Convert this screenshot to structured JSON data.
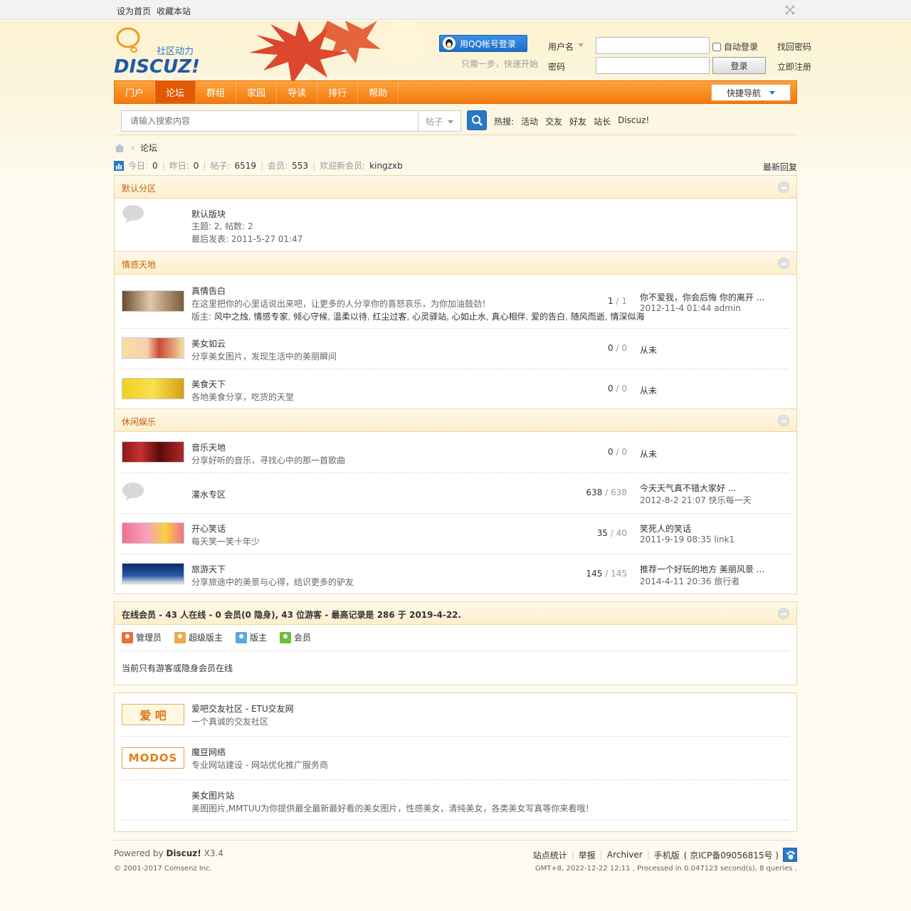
{
  "topbar": {
    "links": [
      "设为首页",
      "收藏本站"
    ]
  },
  "header": {
    "logo_tagline": "社区动力",
    "logo_text": "DISCUZ!",
    "qq_login": "用QQ帐号登录",
    "qq_tip": "只需一步，快速开始",
    "username_label": "用户名",
    "password_label": "密码",
    "auto_login": "自动登录",
    "login_button": "登录",
    "forgot_password": "找回密码",
    "register": "立即注册"
  },
  "nav": {
    "items": [
      "门户",
      "论坛",
      "群组",
      "家园",
      "导读",
      "排行",
      "帮助"
    ],
    "active_index": 1,
    "quick_nav": "快捷导航"
  },
  "search": {
    "placeholder": "请输入搜索内容",
    "type": "帖子",
    "hot_label": "热搜:",
    "hot_items": [
      "活动",
      "交友",
      "好友",
      "站长",
      "Discuz!"
    ]
  },
  "breadcrumb": {
    "current": "论坛"
  },
  "stats": {
    "today_label": "今日:",
    "today": "0",
    "yesterday_label": "昨日:",
    "yesterday": "0",
    "posts_label": "帖子:",
    "posts": "6519",
    "members_label": "会员:",
    "members": "553",
    "newest_label": "欢迎新会员:",
    "newest": "kingzxb",
    "latest_link": "最新回复"
  },
  "sections": [
    {
      "title": "默认分区",
      "forums": [
        {
          "name": "默认版块",
          "topics_line": "主题: 2, 帖数: 2",
          "last_line": "最后发表: 2011-5-27 01:47"
        }
      ]
    },
    {
      "title": "情感天地",
      "forums": [
        {
          "name": "真情告白",
          "desc": "在这里把你的心里话说出来吧，让更多的人分享你的喜怒哀乐，为你加油鼓劲！",
          "mods_label": "版主:",
          "mods": [
            "风中之烛",
            "情感专家",
            "倾心守候",
            "温柔以待",
            "红尘过客",
            "心灵驿站",
            "心如止水",
            "真心相伴",
            "爱的告白",
            "随风而逝",
            "情深似海"
          ],
          "count": "1",
          "count_total": "1",
          "last_title": "你不爱我，你会后悔 你的离开 ...",
          "last_info": "2012-11-4 01:44 admin"
        },
        {
          "name": "美女如云",
          "desc": "分享美女图片，发现生活中的美丽瞬间",
          "count": "0",
          "count_total": "0",
          "last_none": "从未"
        },
        {
          "name": "美食天下",
          "desc": "各地美食分享，吃货的天堂",
          "count": "0",
          "count_total": "0",
          "last_none": "从未"
        }
      ]
    },
    {
      "title": "休闲娱乐",
      "forums": [
        {
          "name": "音乐天地",
          "desc": "分享好听的音乐，寻找心中的那一首歌曲",
          "count": "0",
          "count_total": "0",
          "last_none": "从未"
        },
        {
          "name": "灌水专区",
          "count": "638",
          "count_total": "638",
          "last_title": "今天天气真不错大家好 ...",
          "last_info": "2012-8-2 21:07 快乐每一天"
        },
        {
          "name": "开心笑话",
          "desc": "每天笑一笑十年少",
          "count": "35",
          "count_total": "40",
          "last_title": "笑死人的笑话",
          "last_info": "2011-9-19 08:35 link1"
        },
        {
          "name": "旅游天下",
          "desc": "分享旅途中的美景与心得，结识更多的驴友",
          "count": "145",
          "count_total": "145",
          "last_title": "推荐一个好玩的地方 美丽风景 ...",
          "last_info": "2014-4-11 20:36 旅行者"
        }
      ]
    }
  ],
  "online": {
    "title": "在线会员 - 43 人在线 - 0 会员(0 隐身), 43 位游客 - 最高记录是 286 于 2019-4-22.",
    "legend": [
      {
        "label": "管理员",
        "color": "#e8703a"
      },
      {
        "label": "超级版主",
        "color": "#f0a848"
      },
      {
        "label": "版主",
        "color": "#5aa8e0"
      },
      {
        "label": "会员",
        "color": "#6cbf3c"
      }
    ],
    "empty_text": "当前只有游客或隐身会员在线"
  },
  "links": [
    {
      "name": "爱吧交友社区 - ETU交友网",
      "desc": "一个真诚的交友社区",
      "logo": "爱 吧"
    },
    {
      "name": "魔豆网络",
      "desc": "专业网站建设 - 网站优化推广服务商",
      "logo": "MODOS"
    },
    {
      "name": "美女图片站",
      "desc": "美图图片,MMTUU为你提供最全最新最好看的美女图片，性感美女，清纯美女，各类美女写真等你来看哦！"
    }
  ],
  "footer": {
    "powered_prefix": "Powered by",
    "powered_brand": "Discuz!",
    "powered_version": "X3.4",
    "copyright": "© 2001-2017 Comsenz Inc.",
    "links": [
      "站点统计",
      "举报",
      "Archiver",
      "手机版"
    ],
    "icp": "( 京ICP备09056815号 )",
    "info": "GMT+8, 2022-12-22 12:11 , Processed in 0.047123 second(s), 8 queries ."
  }
}
